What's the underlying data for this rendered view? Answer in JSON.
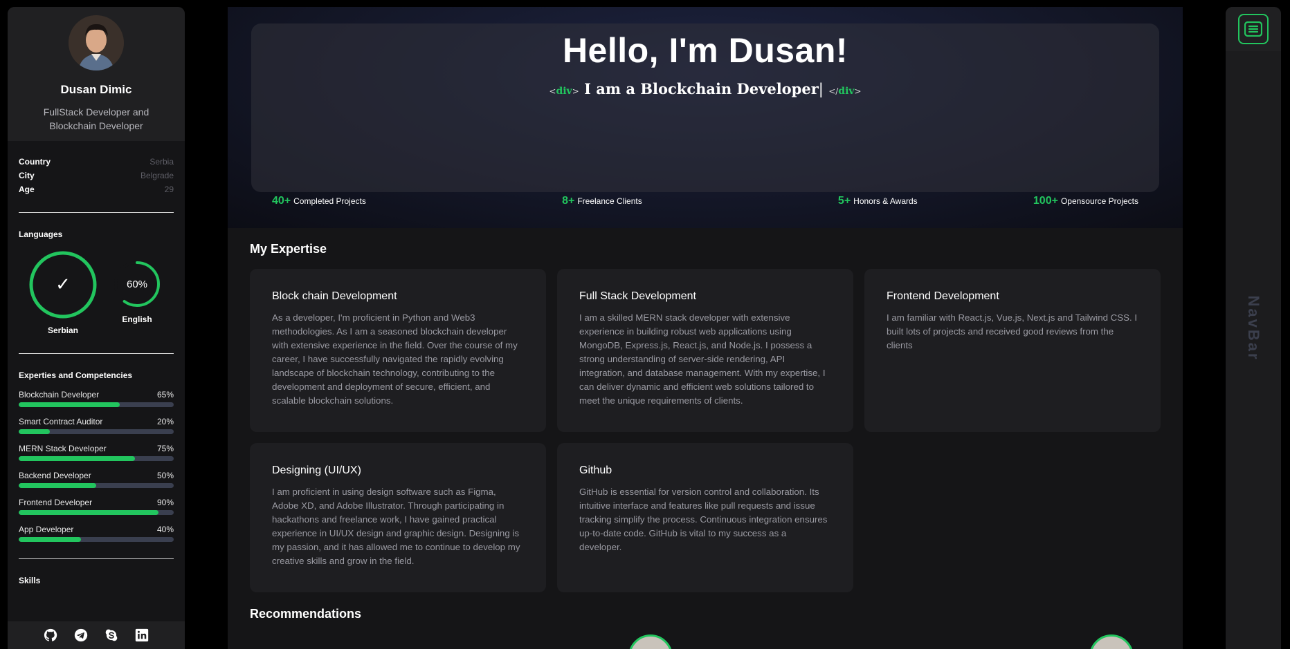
{
  "profile": {
    "name": "Dusan Dimic",
    "role": "FullStack Developer and Blockchain Developer"
  },
  "info": [
    {
      "key": "Country",
      "value": "Serbia"
    },
    {
      "key": "City",
      "value": "Belgrade"
    },
    {
      "key": "Age",
      "value": "29"
    }
  ],
  "languages": {
    "title": "Languages",
    "items": [
      {
        "name": "Serbian",
        "level": 100,
        "display": "✓"
      },
      {
        "name": "English",
        "level": 60,
        "display": "60%"
      }
    ]
  },
  "expertise_side": {
    "title": "Experties and Competencies",
    "items": [
      {
        "name": "Blockchain Developer",
        "percent_label": "65%",
        "level": 65
      },
      {
        "name": "Smart Contract Auditor",
        "percent_label": "20%",
        "level": 20
      },
      {
        "name": "MERN Stack Developer",
        "percent_label": "75%",
        "level": 75
      },
      {
        "name": "Backend Developer",
        "percent_label": "50%",
        "level": 50
      },
      {
        "name": "Frontend Developer",
        "percent_label": "90%",
        "level": 90
      },
      {
        "name": "App Developer",
        "percent_label": "40%",
        "level": 40
      }
    ]
  },
  "skills_title": "Skills",
  "socials": [
    "github-icon",
    "telegram-icon",
    "skype-icon",
    "linkedin-icon"
  ],
  "hero": {
    "title": "Hello, I'm Dusan!",
    "tag_open": "div",
    "tag_close": "div",
    "subtitle": "I am a Blockchain Developer",
    "cursor": "|"
  },
  "stats": [
    {
      "num": "40+",
      "label": "Completed Projects"
    },
    {
      "num": "8+",
      "label": "Freelance Clients"
    },
    {
      "num": "5+",
      "label": "Honors & Awards"
    },
    {
      "num": "100+",
      "label": "Opensource Projects"
    }
  ],
  "expertise": {
    "title": "My Expertise",
    "cards": [
      {
        "title": "Block chain Development",
        "text": "As a developer, I'm proficient in Python and Web3 methodologies. As I am a seasoned blockchain developer with extensive experience in the field. Over the course of my career, I have successfully navigated the rapidly evolving landscape of blockchain technology, contributing to the development and deployment of secure, efficient, and scalable blockchain solutions."
      },
      {
        "title": "Full Stack Development",
        "text": "I am a skilled MERN stack developer with extensive experience in building robust web applications using MongoDB, Express.js, React.js, and Node.js. I possess a strong understanding of server-side rendering, API integration, and database management. With my expertise, I can deliver dynamic and efficient web solutions tailored to meet the unique requirements of clients."
      },
      {
        "title": "Frontend Development",
        "text": "I am familiar with React.js, Vue.js, Next.js and Tailwind CSS. I built lots of projects and received good reviews from the clients"
      },
      {
        "title": "Designing (UI/UX)",
        "text": "I am proficient in using design software such as Figma, Adobe XD, and Adobe Illustrator. Through participating in hackathons and freelance work, I have gained practical experience in UI/UX design and graphic design. Designing is my passion, and it has allowed me to continue to develop my creative skills and grow in the field."
      },
      {
        "title": "Github",
        "text": "GitHub is essential for version control and collaboration. Its intuitive interface and features like pull requests and issue tracking simplify the process. Continuous integration ensures up-to-date code. GitHub is vital to my success as a developer."
      }
    ]
  },
  "recommendations_title": "Recommendations",
  "navbar": {
    "label": "NavBar",
    "menu_icon": "menu-icon"
  },
  "colors": {
    "accent": "#22c55e",
    "bg": "#151517",
    "card": "#1e1e21"
  }
}
